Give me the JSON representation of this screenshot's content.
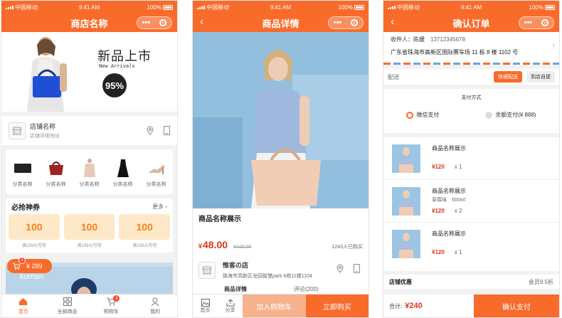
{
  "status": {
    "carrier": "中国移动",
    "time": "9:41 AM",
    "battery": "100%"
  },
  "home": {
    "title": "商店名称",
    "banner": {
      "headline": "新品上市",
      "sub": "New Arrivals",
      "badge": "95%"
    },
    "shop": {
      "name": "店铺名称",
      "addr": "店铺详细地址"
    },
    "categories": [
      "分类名称",
      "分类名称",
      "分类名称",
      "分类名称",
      "分类名称"
    ],
    "coupons": {
      "title": "必抢神券",
      "more": "更多",
      "items": [
        {
          "amount": "100",
          "cond": "满199元可用"
        },
        {
          "amount": "100",
          "cond": "满199元可用"
        },
        {
          "amount": "100",
          "cond": "满199元可用"
        }
      ]
    },
    "cart": {
      "count": "2",
      "price": "¥ 289"
    },
    "promo_text": "kuman",
    "tabs": [
      {
        "label": "首页"
      },
      {
        "label": "全部商品"
      },
      {
        "label": "购物车",
        "badge": "3"
      },
      {
        "label": "我的"
      }
    ]
  },
  "detail": {
    "title": "商品详情",
    "name": "商品名称展示",
    "price_symbol": "¥",
    "price": "48.00",
    "old_price": "¥100.00",
    "sold": "1243人已购买",
    "store": {
      "name": "惟客の店",
      "addr": "珠海市高新区龙园智慧park 6栋11楼1104"
    },
    "tabs": [
      "商品详情",
      "评论(200)"
    ],
    "bottom": {
      "home": "首页",
      "share": "分享",
      "add": "加入购物车",
      "buy": "立即购买"
    }
  },
  "order": {
    "title": "确认订单",
    "receiver_label": "收件人：",
    "receiver": "陈媛",
    "phone": "13712345678",
    "address": "广东省珠海市高新区国际赛车场 11 栋 8 楼 1102 号",
    "delivery_label": "配送",
    "delivery_options": [
      "快递配送",
      "到店自提"
    ],
    "pay_title": "支付方式",
    "pay_options": [
      "微信支付",
      "余额支付(¥ 888)"
    ],
    "items": [
      {
        "name": "商品名称展示",
        "spec": "",
        "price": "¥120",
        "qty": "x 1"
      },
      {
        "name": "商品名称展示",
        "spec": "草莓味　500ml",
        "price": "¥120",
        "qty": "x 2"
      },
      {
        "name": "商品名称展示",
        "spec": "",
        "price": "¥120",
        "qty": "x 1"
      }
    ],
    "discount_label": "店铺优惠",
    "discount_value": "会员9.5折",
    "total_label": "合计:",
    "total": "¥240",
    "confirm": "确认支付"
  },
  "colors": {
    "accent": "#f96b2b",
    "price": "#e0341d"
  }
}
